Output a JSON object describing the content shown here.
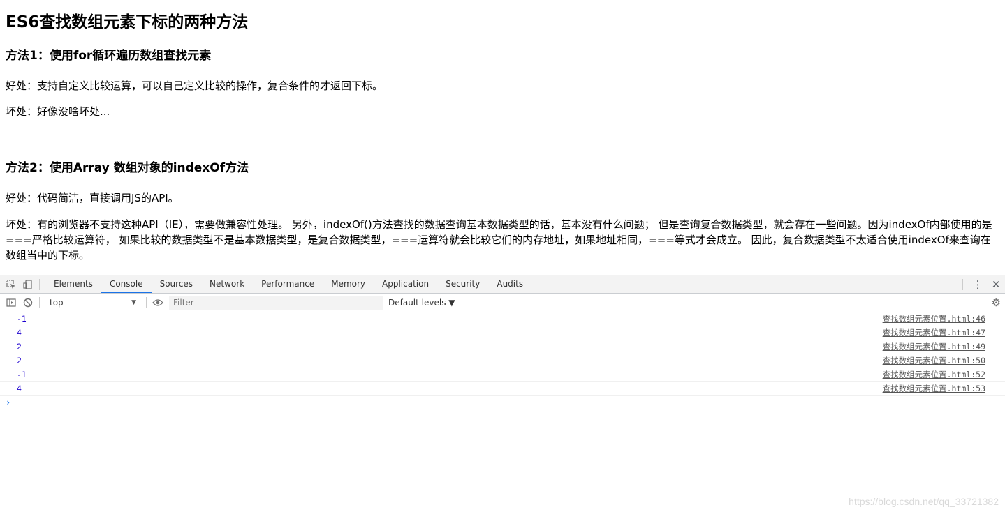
{
  "page": {
    "title": "ES6查找数组元素下标的两种方法",
    "method1": {
      "title": "方法1：使用for循环遍历数组查找元素",
      "pros": "好处：支持自定义比较运算，可以自己定义比较的操作，复合条件的才返回下标。",
      "cons": "坏处：好像没啥坏处..."
    },
    "method2": {
      "title": "方法2：使用Array 数组对象的indexOf方法",
      "pros": "好处：代码简洁，直接调用JS的API。",
      "cons": "坏处：有的浏览器不支持这种API（IE），需要做兼容性处理。 另外，indexOf()方法查找的数据查询基本数据类型的话，基本没有什么问题； 但是查询复合数据类型，就会存在一些问题。因为indexOf内部使用的是===严格比较运算符， 如果比较的数据类型不是基本数据类型，是复合数据类型，===运算符就会比较它们的内存地址，如果地址相同，===等式才会成立。 因此，复合数据类型不太适合使用indexOf来查询在数组当中的下标。"
    }
  },
  "devtools": {
    "tabs": [
      "Elements",
      "Console",
      "Sources",
      "Network",
      "Performance",
      "Memory",
      "Application",
      "Security",
      "Audits"
    ],
    "active_tab": "Console",
    "context": "top",
    "filter_placeholder": "Filter",
    "levels": "Default levels ▼",
    "logs": [
      {
        "value": "-1",
        "source": "查找数组元素位置.html:46"
      },
      {
        "value": "4",
        "source": "查找数组元素位置.html:47"
      },
      {
        "value": "2",
        "source": "查找数组元素位置.html:49"
      },
      {
        "value": "2",
        "source": "查找数组元素位置.html:50"
      },
      {
        "value": "-1",
        "source": "查找数组元素位置.html:52"
      },
      {
        "value": "4",
        "source": "查找数组元素位置.html:53"
      }
    ],
    "prompt": "›"
  },
  "icons": {
    "inspect": "inspect-element-icon",
    "device": "device-toolbar-icon",
    "sidebar": "console-sidebar-icon",
    "clear": "clear-console-icon",
    "eye": "live-expression-icon",
    "more": "more-vertical-icon",
    "close": "close-icon",
    "settings": "gear-icon"
  },
  "watermark": "https://blog.csdn.net/qq_33721382"
}
